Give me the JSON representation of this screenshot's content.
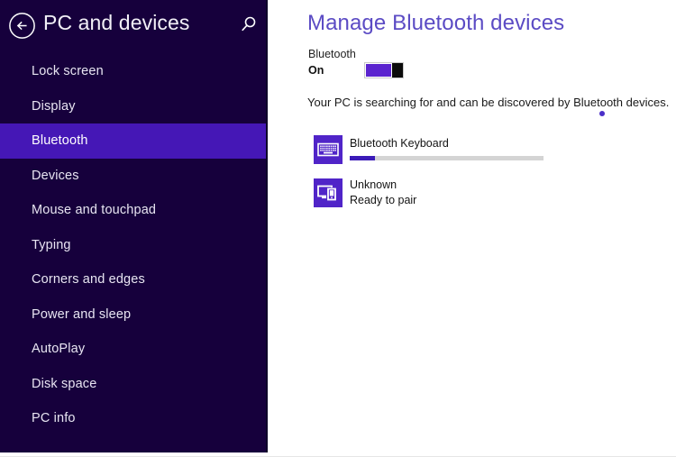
{
  "window": {
    "accent_purple": "#4517b6",
    "sidebar_bg": "#16003c",
    "title_purple": "#5b4bc4",
    "toggle_purple": "#5b24cf"
  },
  "sidebar": {
    "header": {
      "title": "PC and devices",
      "back_icon": "back-arrow-icon",
      "search_icon": "search-icon"
    },
    "items": [
      {
        "label": "Lock screen",
        "selected": false
      },
      {
        "label": "Display",
        "selected": false
      },
      {
        "label": "Bluetooth",
        "selected": true
      },
      {
        "label": "Devices",
        "selected": false
      },
      {
        "label": "Mouse and touchpad",
        "selected": false
      },
      {
        "label": "Typing",
        "selected": false
      },
      {
        "label": "Corners and edges",
        "selected": false
      },
      {
        "label": "Power and sleep",
        "selected": false
      },
      {
        "label": "AutoPlay",
        "selected": false
      },
      {
        "label": "Disk space",
        "selected": false
      },
      {
        "label": "PC info",
        "selected": false
      }
    ]
  },
  "main": {
    "title": "Manage Bluetooth devices",
    "bluetooth": {
      "section_label": "Bluetooth",
      "toggle_state": "On",
      "toggle_on": true
    },
    "status_text": "Your PC is searching for and can be discovered by Bluetooth devices.",
    "searching_indicator": "progress-dot",
    "devices": [
      {
        "name": "Bluetooth  Keyboard",
        "subtitle": "",
        "icon": "keyboard-icon",
        "progress_percent": 13,
        "has_progress": true
      },
      {
        "name": "Unknown",
        "subtitle": "Ready to pair",
        "icon": "monitor-phone-icon",
        "progress_percent": 0,
        "has_progress": false
      }
    ]
  }
}
